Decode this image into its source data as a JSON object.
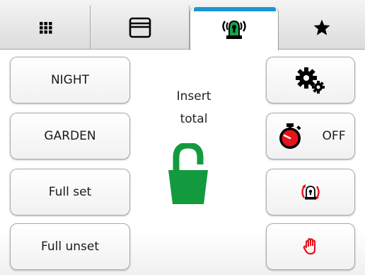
{
  "tabs": [
    {
      "icon": "grid-icon"
    },
    {
      "icon": "window-icon"
    },
    {
      "icon": "alarm-beacon-icon",
      "active": true
    },
    {
      "icon": "star-icon"
    }
  ],
  "colors": {
    "accent": "#1a96d8",
    "lock": "#139a3f",
    "red": "#e8141c",
    "beacon_green": "#17a34a"
  },
  "left_buttons": [
    {
      "label": "NIGHT"
    },
    {
      "label": "GARDEN"
    },
    {
      "label": "Full set"
    },
    {
      "label": "Full unset"
    }
  ],
  "status": {
    "line1": "Insert",
    "line2": "total",
    "icon": "padlock-open-icon"
  },
  "right_buttons": {
    "settings": {
      "icon": "gears-icon"
    },
    "timer": {
      "icon": "stopwatch-icon",
      "label": "OFF"
    },
    "siren": {
      "icon": "siren-rotate-icon"
    },
    "panic": {
      "icon": "hand-stop-icon"
    }
  }
}
